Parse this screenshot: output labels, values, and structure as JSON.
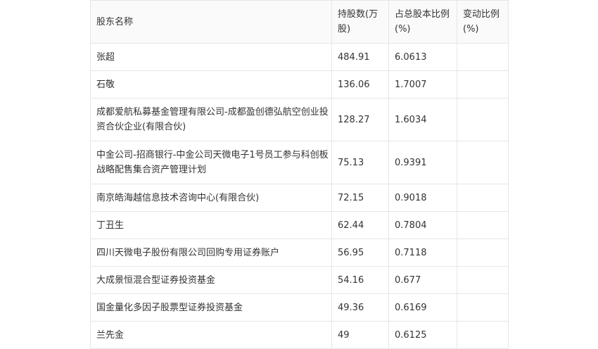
{
  "table": {
    "headers": [
      "股东名称",
      "持股数(万股)",
      "占总股本比例(%)",
      "变动比例(%)"
    ],
    "rows": [
      {
        "name": "张超",
        "shares": "484.91",
        "ratio": "6.0613",
        "change": ""
      },
      {
        "name": "石敬",
        "shares": "136.06",
        "ratio": "1.7007",
        "change": ""
      },
      {
        "name": "成都爱航私募基金管理有限公司-成都盈创德弘航空创业投资合伙企业(有限合伙)",
        "shares": "128.27",
        "ratio": "1.6034",
        "change": ""
      },
      {
        "name": "中金公司-招商银行-中金公司天微电子1号员工参与科创板战略配售集合资产管理计划",
        "shares": "75.13",
        "ratio": "0.9391",
        "change": ""
      },
      {
        "name": "南京皓海越信息技术咨询中心(有限合伙)",
        "shares": "72.15",
        "ratio": "0.9018",
        "change": ""
      },
      {
        "name": "丁丑生",
        "shares": "62.44",
        "ratio": "0.7804",
        "change": ""
      },
      {
        "name": "四川天微电子股份有限公司回购专用证券账户",
        "shares": "56.95",
        "ratio": "0.7118",
        "change": ""
      },
      {
        "name": "大成景恒混合型证券投资基金",
        "shares": "54.16",
        "ratio": "0.677",
        "change": ""
      },
      {
        "name": "国金量化多因子股票型证券投资基金",
        "shares": "49.36",
        "ratio": "0.6169",
        "change": ""
      },
      {
        "name": "兰先金",
        "shares": "49",
        "ratio": "0.6125",
        "change": ""
      }
    ]
  }
}
